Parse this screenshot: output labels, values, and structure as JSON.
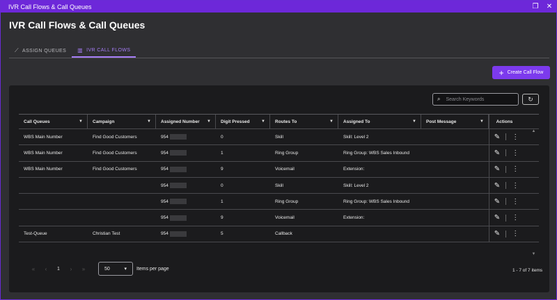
{
  "window": {
    "title": "IVR Call Flows & Call Queues"
  },
  "page": {
    "title": "IVR Call Flows & Call Queues"
  },
  "tabs": [
    {
      "label": "ASSIGN QUEUES",
      "icon": "chart-line-icon"
    },
    {
      "label": "IVR CALL FLOWS",
      "icon": "bar-chart-icon"
    }
  ],
  "create_button": {
    "label": "Create Call Flow"
  },
  "search": {
    "placeholder": "Search Keywords"
  },
  "table": {
    "headers": [
      "Call Queues",
      "Campaign",
      "Assigned Number",
      "Digit Pressed",
      "Routes To",
      "Assigned To",
      "Post Message",
      "Actions"
    ],
    "rows": [
      [
        "WBS Main Number",
        "Find Good Customers",
        "954",
        "0",
        "Skill",
        "Skill: Level 2",
        ""
      ],
      [
        "WBS Main Number",
        "Find Good Customers",
        "954",
        "1",
        "Ring Group",
        "Ring Group: WBS Sales Inbound",
        ""
      ],
      [
        "WBS Main Number",
        "Find Good Customers",
        "954",
        "9",
        "Voicemail",
        "Extension:",
        ""
      ],
      [
        "",
        "",
        "954",
        "0",
        "Skill",
        "Skill: Level 2",
        ""
      ],
      [
        "",
        "",
        "954",
        "1",
        "Ring Group",
        "Ring Group: WBS Sales Inbound",
        ""
      ],
      [
        "",
        "",
        "954",
        "9",
        "Voicemail",
        "Extension:",
        ""
      ],
      [
        "Test-Queue",
        "Christian Test",
        "954",
        "5",
        "Callback",
        "",
        ""
      ]
    ]
  },
  "pagination": {
    "page": "1",
    "page_size": "50",
    "items_per_page_label": "Items per page",
    "count": "1 - 7 of 7 items"
  },
  "colors": {
    "accent": "#7c3aed",
    "titlebar": "#6d28d9"
  }
}
